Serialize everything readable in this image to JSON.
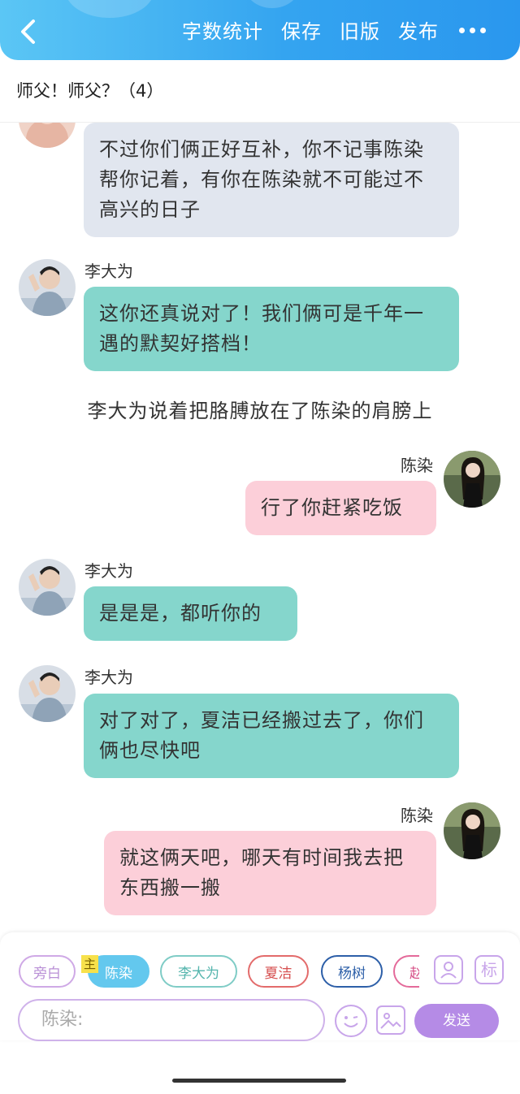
{
  "header": {
    "menu": [
      "字数统计",
      "保存",
      "旧版",
      "发布"
    ]
  },
  "chapter": {
    "title": "师父！师父？（4）"
  },
  "messages": [
    {
      "text": "不过你们俩正好互补，你不记事陈染帮你记着，有你在陈染就不可能过不高兴的日子"
    },
    {
      "speaker": "李大为",
      "text": "这你还真说对了！我们俩可是千年一遇的默契好搭档！"
    },
    {
      "narration": "李大为说着把胳膊放在了陈染的肩膀上"
    },
    {
      "speaker": "陈染",
      "text": "行了你赶紧吃饭"
    },
    {
      "speaker": "李大为",
      "text": "是是是，都听你的"
    },
    {
      "speaker": "李大为",
      "text": "对了对了，夏洁已经搬过去了，你们俩也尽快吧"
    },
    {
      "speaker": "陈染",
      "text": "就这俩天吧，哪天有时间我去把东西搬一搬"
    }
  ],
  "roles": [
    "旁白",
    "陈染",
    "李大为",
    "夏洁",
    "杨树",
    "赵"
  ],
  "main_badge": "主",
  "tag_button": "标",
  "input": {
    "placeholder": "陈染:"
  },
  "send_label": "发送",
  "colors": {
    "header": "#34a4f0",
    "gray_bubble": "#e1e6ef",
    "teal_bubble": "#85d6cc",
    "pink_bubble": "#fccfd9",
    "send": "#b58be6"
  }
}
